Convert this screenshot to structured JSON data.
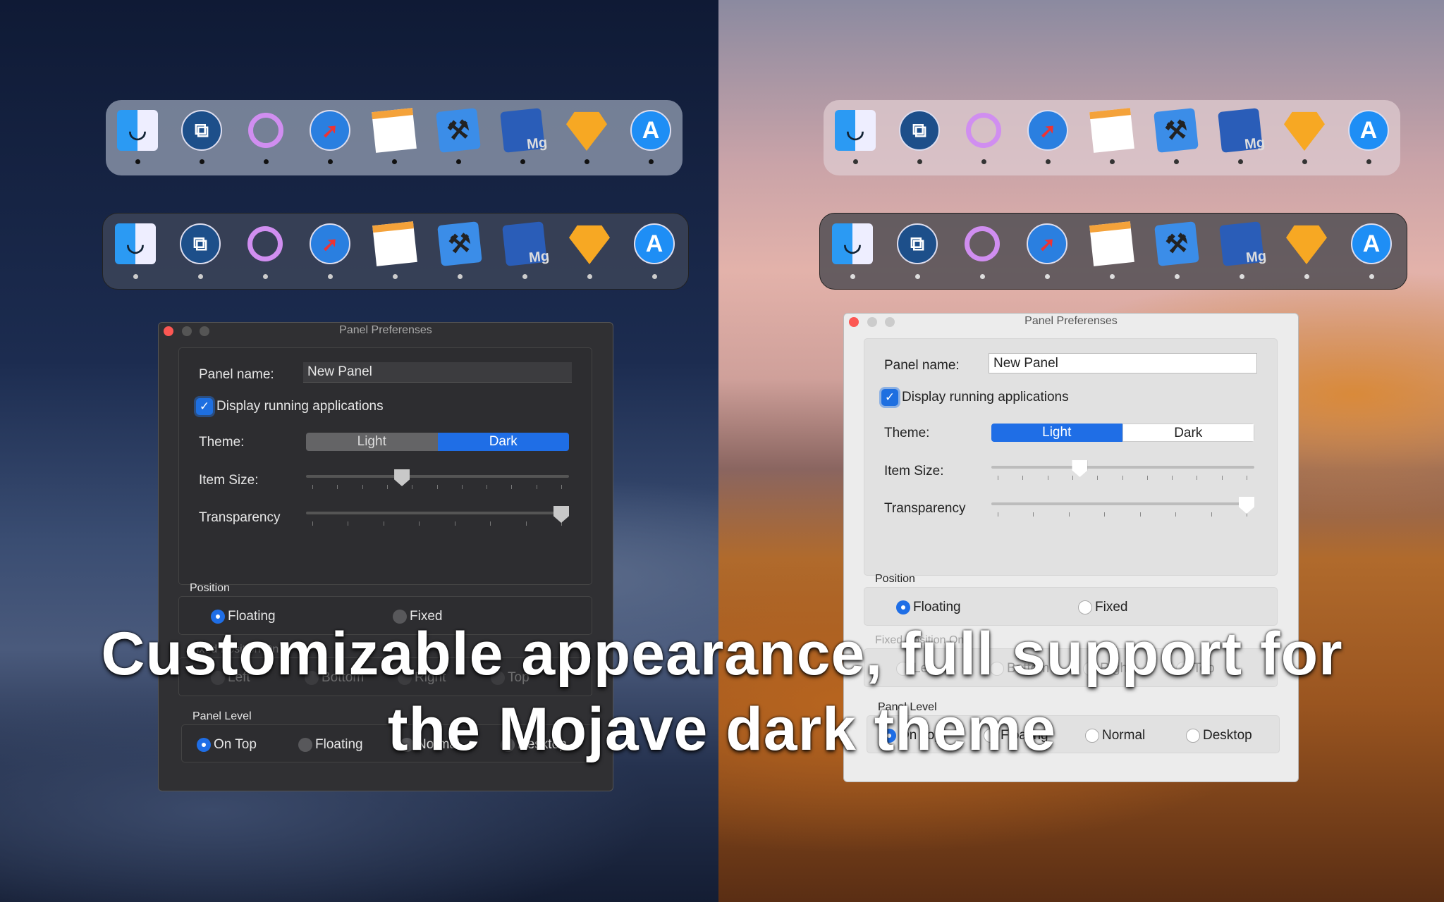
{
  "caption": {
    "line1": "Customizable appearance, full support for",
    "line2": "the Mojave dark theme"
  },
  "dock_apps": [
    {
      "name": "finder",
      "icon": "finder-icon",
      "color": "#2b9af3"
    },
    {
      "name": "screenshot",
      "icon": "screenshot-icon",
      "color": "#1d4f8a"
    },
    {
      "name": "siri",
      "icon": "siri-ring-icon",
      "color": "#d08ef0"
    },
    {
      "name": "safari",
      "icon": "safari-compass-icon",
      "color": "#2a7fe0"
    },
    {
      "name": "pages",
      "icon": "pages-icon",
      "color": "#f4a23a"
    },
    {
      "name": "xcode",
      "icon": "xcode-hammer-icon",
      "color": "#3b8de8"
    },
    {
      "name": "mg",
      "icon": "mg-arrow-icon",
      "color": "#2a5db8",
      "text": "Mg"
    },
    {
      "name": "sketch",
      "icon": "sketch-diamond-icon",
      "color": "#f7a823"
    },
    {
      "name": "app-store",
      "icon": "app-store-icon",
      "color": "#1e8ef5"
    }
  ],
  "windows": {
    "dark": {
      "title": "Panel Preferenses",
      "panel_name_label": "Panel name:",
      "panel_name_value": "New Panel",
      "display_running_label": "Display running applications",
      "display_running_checked": true,
      "theme_label": "Theme:",
      "theme_options": [
        "Light",
        "Dark"
      ],
      "theme_selected": "Dark",
      "item_size_label": "Item Size:",
      "item_size_value": 0.36,
      "transparency_label": "Transparency",
      "transparency_value": 1.0,
      "position_label": "Position",
      "position_options": [
        "Floating",
        "Fixed"
      ],
      "position_selected": "Floating",
      "fixed_position_label": "Fixed Position On",
      "fixed_position_options": [
        "Left",
        "Bottom",
        "Right",
        "Top"
      ],
      "fixed_position_selected": "Bottom",
      "panel_level_label": "Panel Level",
      "panel_level_options": [
        "On Top",
        "Floating",
        "Normal",
        "Desktop"
      ],
      "panel_level_selected": "On Top"
    },
    "light": {
      "title": "Panel Preferenses",
      "panel_name_label": "Panel name:",
      "panel_name_value": "New Panel",
      "display_running_label": "Display running applications",
      "display_running_checked": true,
      "theme_label": "Theme:",
      "theme_options": [
        "Light",
        "Dark"
      ],
      "theme_selected": "Light",
      "item_size_label": "Item Size:",
      "item_size_value": 0.33,
      "transparency_label": "Transparency",
      "transparency_value": 1.0,
      "position_label": "Position",
      "position_options": [
        "Floating",
        "Fixed"
      ],
      "position_selected": "Floating",
      "fixed_position_label": "Fixed Position On",
      "fixed_position_options": [
        "Left",
        "Bottom",
        "Right",
        "Top"
      ],
      "fixed_position_selected": "Bottom",
      "panel_level_label": "Panel Level",
      "panel_level_options": [
        "On Top",
        "Floating",
        "Normal",
        "Desktop"
      ],
      "panel_level_selected": "On Top"
    }
  },
  "colors": {
    "accent": "#1f6ee6",
    "close": "#fc5753"
  }
}
